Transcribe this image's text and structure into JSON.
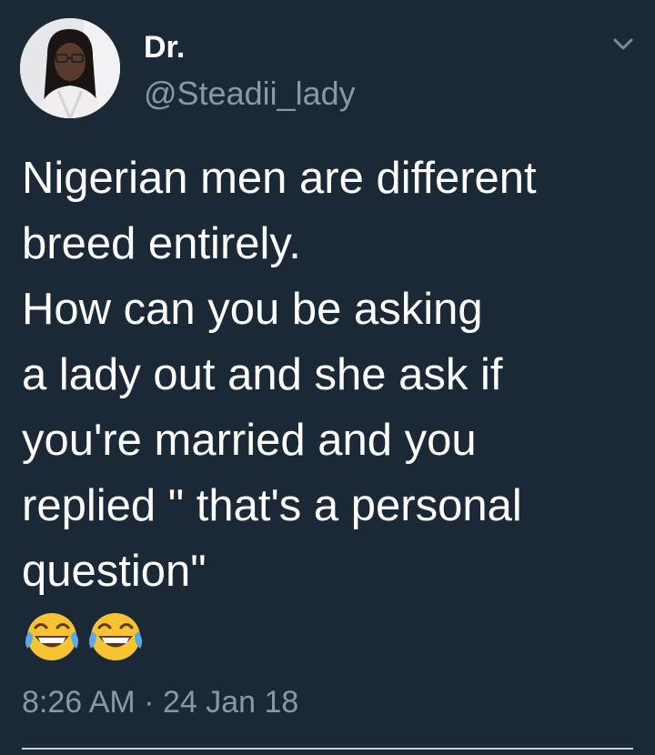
{
  "tweet": {
    "author": {
      "display_name": "Dr.",
      "handle": "@Steadii_lady",
      "avatar_icon": "profile-photo"
    },
    "menu_icon": "chevron-down-icon",
    "text_lines": [
      "Nigerian men are different",
      "breed entirely.",
      "How can you be asking",
      "a lady out and she ask if",
      "you're married and you",
      "replied \" that's a personal",
      "question\""
    ],
    "emojis": [
      "face-with-tears-of-joy-icon",
      "face-with-tears-of-joy-icon"
    ],
    "timestamp": "8:26 AM · 24 Jan 18"
  },
  "colors": {
    "background": "#1b2836",
    "primary_text": "#ffffff",
    "secondary_text": "#8899a6",
    "emoji_yellow": "#f7c331"
  }
}
